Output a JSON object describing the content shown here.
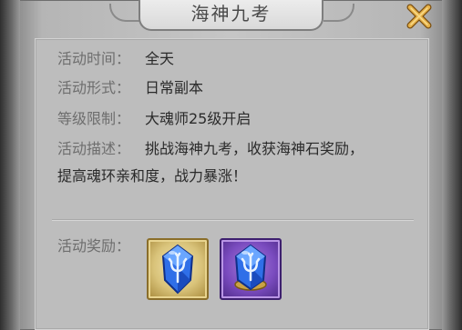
{
  "title": "海神九考",
  "close_icon": "close-x-icon",
  "info": {
    "time_label": "活动时间：",
    "time_value": "全天",
    "form_label": "活动形式：",
    "form_value": "日常副本",
    "level_label": "等级限制：",
    "level_value": "大魂师25级开启",
    "desc_label": "活动描述：",
    "desc_line1": "挑战海神九考，收获海神石奖励，",
    "desc_line2": "提高魂环亲和度，战力暴涨！"
  },
  "rewards": {
    "label": "活动奖励：",
    "items": [
      {
        "name": "sea-god-stone-icon",
        "frame": "gold"
      },
      {
        "name": "sea-god-stone-icon",
        "frame": "purple"
      }
    ]
  },
  "colors": {
    "label_gray": "#6e6e6e",
    "value_dark": "#2a2a2a",
    "close_gold": "#d9a441",
    "gem_blue": "#3a7bff"
  }
}
